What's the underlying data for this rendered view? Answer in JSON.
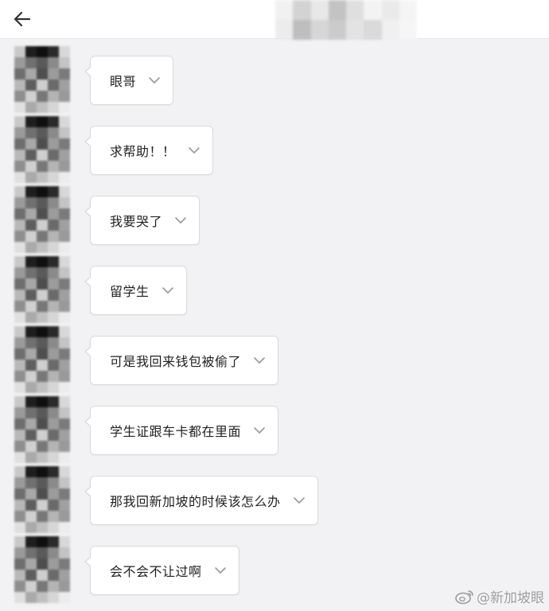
{
  "header": {
    "back_icon": "arrow-left-icon",
    "title": ""
  },
  "messages": [
    {
      "text": "眼哥"
    },
    {
      "text": "求帮助！！"
    },
    {
      "text": "我要哭了"
    },
    {
      "text": "留学生"
    },
    {
      "text": "可是我回来钱包被偷了"
    },
    {
      "text": "学生证跟车卡都在里面"
    },
    {
      "text": "那我回新加坡的时候该怎么办"
    },
    {
      "text": "会不会不让过啊"
    }
  ],
  "watermark": {
    "logo": "weibo-logo",
    "text": "@新加坡眼"
  },
  "colors": {
    "background": "#f2f2f5",
    "bubble": "#ffffff",
    "bubble_border": "#d9d9d9",
    "text": "#222222"
  }
}
